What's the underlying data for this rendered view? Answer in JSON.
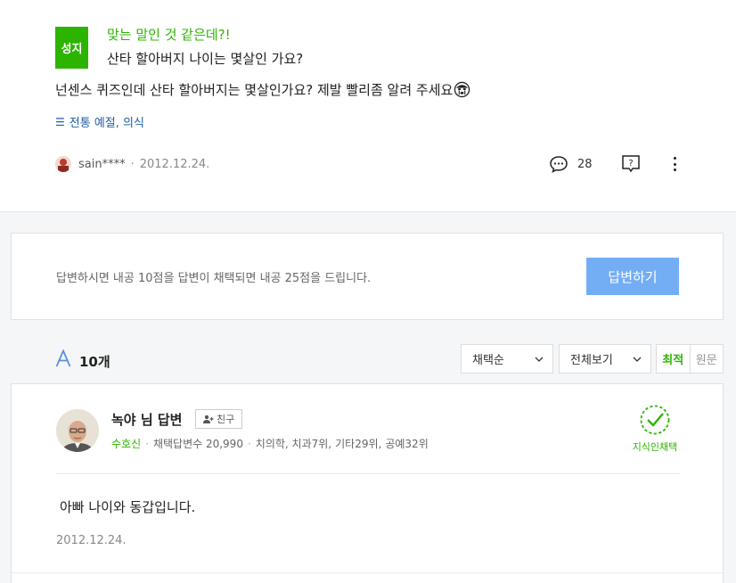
{
  "question": {
    "badge": "성지",
    "subtitle": "맞는 말인 것 같은데?!",
    "title": "산타 할아버지 나이는 몇살인 가요?",
    "body": "넌센스 퀴즈인데 산타 할아버지는 몇살인가요? 제발 빨리좀 알려 주세요",
    "tag": "전통 예절, 의식",
    "author": "sain****",
    "date": "2012.12.24.",
    "comment_count": "28"
  },
  "point_box": {
    "text": "답변하시면 내공 10점을 답변이 채택되면 내공 25점을 드립니다.",
    "button": "답변하기"
  },
  "answers_bar": {
    "count": "10개",
    "sort_select": "채택순",
    "filter_select": "전체보기",
    "sort_latest": "최적",
    "sort_original": "원문"
  },
  "answer": {
    "name": "녹야 님 답변",
    "friend_button": "친구",
    "grade": "수호신",
    "selected_count": "채택답변수 20,990",
    "rank1": "치의학, 치과7위,",
    "rank2": "기타29위,",
    "rank3": "공예32위",
    "chosen_label": "지식인채택",
    "body": "아빠 나이와 동갑입니다.",
    "date": "2012.12.24."
  },
  "colors": {
    "brand_green": "#2db400",
    "button_blue": "#73aef5",
    "tag_blue": "#1f5ea8"
  }
}
